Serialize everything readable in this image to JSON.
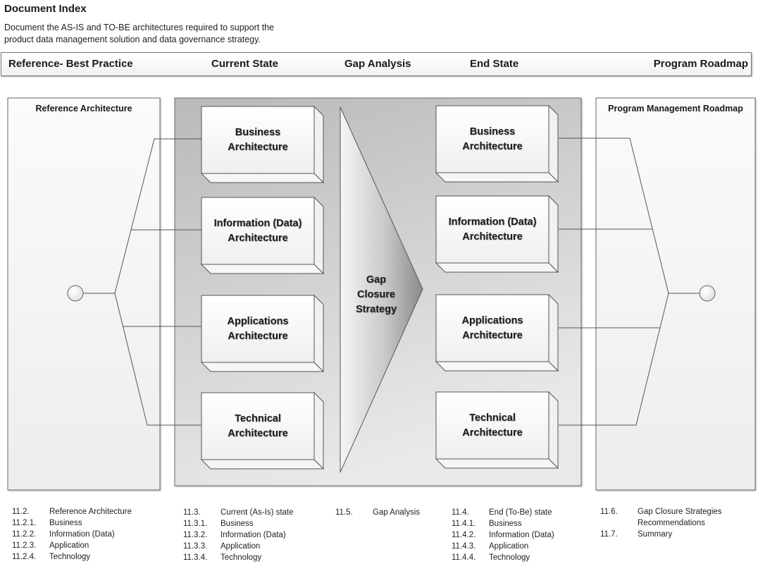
{
  "header": {
    "title": "Document Index",
    "description_line1": "Document the AS-IS and TO-BE architectures required to support the",
    "description_line2": "product data management solution and data governance strategy."
  },
  "phases": [
    "Reference- Best Practice",
    "Current State",
    "Gap Analysis",
    "End State",
    "Program Roadmap"
  ],
  "diagram": {
    "left_panel_title": "Reference Architecture",
    "right_panel_title": "Program Management Roadmap",
    "arrow_label": [
      "Gap",
      "Closure",
      "Strategy"
    ],
    "current_state_boxes": [
      [
        "Business",
        "Architecture"
      ],
      [
        "Information (Data)",
        "Architecture"
      ],
      [
        "Applications",
        "Architecture"
      ],
      [
        "Technical",
        "Architecture"
      ]
    ],
    "end_state_boxes": [
      [
        "Business",
        "Architecture"
      ],
      [
        "Information (Data)",
        "Architecture"
      ],
      [
        "Applications",
        "Architecture"
      ],
      [
        "Technical",
        "Architecture"
      ]
    ],
    "colors": {
      "outer_panel_bg": "#c4c4c4",
      "side_panel_bg": "#f7f7f7",
      "line": "#555555",
      "box_bg": "#fafafa"
    }
  },
  "index": {
    "col1": [
      {
        "num": "11.2.",
        "label": "Reference Architecture"
      },
      {
        "num": "11.2.1.",
        "label": "Business"
      },
      {
        "num": "11.2.2.",
        "label": "Information (Data)"
      },
      {
        "num": "11.2.3.",
        "label": "Application"
      },
      {
        "num": "11.2.4.",
        "label": "Technology"
      }
    ],
    "col2": [
      {
        "num": "11.3.",
        "label": "Current (As-Is) state"
      },
      {
        "num": "11.3.1.",
        "label": "Business"
      },
      {
        "num": "11.3.2.",
        "label": "Information (Data)"
      },
      {
        "num": "11.3.3.",
        "label": "Application"
      },
      {
        "num": "11.3.4.",
        "label": "Technology"
      }
    ],
    "col3": [
      {
        "num": "11.5.",
        "label": "Gap Analysis"
      }
    ],
    "col4": [
      {
        "num": "11.4.",
        "label": "End (To-Be) state"
      },
      {
        "num": "11.4.1.",
        "label": "Business"
      },
      {
        "num": "11.4.2.",
        "label": "Information (Data)"
      },
      {
        "num": "11.4.3.",
        "label": "Application"
      },
      {
        "num": "11.4.4.",
        "label": "Technology"
      }
    ],
    "col5": [
      {
        "num": "11.6.",
        "label": "Gap Closure Strategies"
      },
      {
        "num": "",
        "label": "Recommendations"
      },
      {
        "num": "11.7.",
        "label": "Summary"
      }
    ]
  }
}
